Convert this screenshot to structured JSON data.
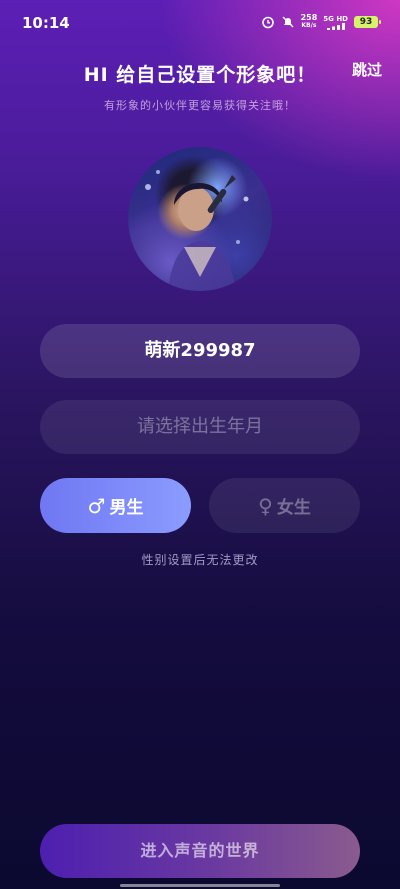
{
  "status_bar": {
    "time": "10:14",
    "net_speed_value": "258",
    "net_speed_unit": "KB/s",
    "signal_label_top": "5G HD",
    "battery_level": "93",
    "battery_color": "#d8f26a",
    "icons": [
      "alarm-icon",
      "mute-notification-icon",
      "signal-icon",
      "battery-icon"
    ]
  },
  "header": {
    "title": "HI 给自己设置个形象吧！",
    "skip_label": "跳过",
    "subtitle": "有形象的小伙伴更容易获得关注哦！"
  },
  "form": {
    "nickname_value": "萌新299987",
    "birthdate_placeholder": "请选择出生年月",
    "gender": {
      "male_label": "男生",
      "male_icon": "male-symbol-icon",
      "female_label": "女生",
      "female_icon": "female-symbol-icon",
      "selected": "male",
      "note": "性别设置后无法更改"
    }
  },
  "footer": {
    "enter_label": "进入声音的世界"
  },
  "colors": {
    "accent": "#7b87f8",
    "background_top": "#5d1fb6",
    "background_bottom": "#0b0930"
  }
}
